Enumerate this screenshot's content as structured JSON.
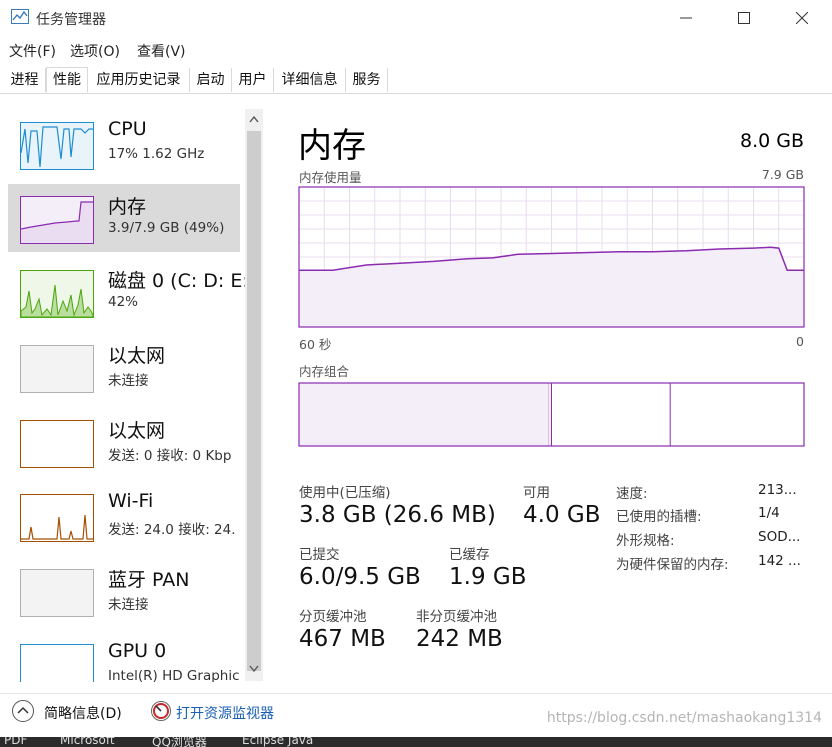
{
  "window": {
    "title": "任务管理器"
  },
  "menu": [
    "文件(F)",
    "选项(O)",
    "查看(V)"
  ],
  "tabs": [
    "进程",
    "性能",
    "应用历史记录",
    "启动",
    "用户",
    "详细信息",
    "服务"
  ],
  "active_tab_index": 1,
  "sidebar": [
    {
      "title": "CPU",
      "subtitle": "17% 1.62 GHz",
      "color": "#1d8ed1",
      "selected": false
    },
    {
      "title": "内存",
      "subtitle": "3.9/7.9 GB (49%)",
      "color": "#8b2bb0",
      "selected": true
    },
    {
      "title": "磁盘 0 (C: D: E:",
      "subtitle": "42%",
      "color": "#4da60c",
      "selected": false
    },
    {
      "title": "以太网",
      "subtitle": "未连接",
      "color": "#a9a9a9",
      "selected": false
    },
    {
      "title": "以太网",
      "subtitle": "发送: 0 接收: 0 Kbp",
      "color": "#a74f01",
      "selected": false
    },
    {
      "title": "Wi-Fi",
      "subtitle": "发送: 24.0 接收: 24.",
      "color": "#a74f01",
      "selected": false
    },
    {
      "title": "蓝牙 PAN",
      "subtitle": "未连接",
      "color": "#a9a9a9",
      "selected": false
    },
    {
      "title": "GPU 0",
      "subtitle": "Intel(R) HD Graphic",
      "color": "#1d8ed1",
      "selected": false
    }
  ],
  "main": {
    "title": "内存",
    "total": "8.0 GB",
    "usage_label": "内存使用量",
    "usage_max": "7.9 GB",
    "x_left": "60 秒",
    "x_right": "0",
    "composition_label": "内存组合",
    "stats": [
      {
        "label": "使用中(已压缩)",
        "value": "3.8 GB (26.6 MB)"
      },
      {
        "label": "可用",
        "value": "4.0 GB"
      },
      {
        "label": "已提交",
        "value": "6.0/9.5 GB"
      },
      {
        "label": "已缓存",
        "value": "1.9 GB"
      },
      {
        "label": "分页缓冲池",
        "value": "467 MB"
      },
      {
        "label": "非分页缓冲池",
        "value": "242 MB"
      }
    ],
    "details": [
      {
        "label": "速度:",
        "value": "213..."
      },
      {
        "label": "已使用的插槽:",
        "value": "1/4"
      },
      {
        "label": "外形规格:",
        "value": "SOD..."
      },
      {
        "label": "为硬件保留的内存:",
        "value": "142 ..."
      }
    ]
  },
  "chart_data": {
    "type": "area",
    "title": "内存使用量",
    "x_range": [
      60,
      0
    ],
    "ylim": [
      0,
      7.9
    ],
    "y_unit": "GB",
    "x": [
      60,
      56,
      52,
      48,
      44,
      40,
      37,
      34,
      30,
      26,
      22,
      18,
      14,
      10,
      6,
      4,
      3,
      2,
      0
    ],
    "values": [
      3.2,
      3.2,
      3.5,
      3.6,
      3.7,
      3.85,
      3.9,
      4.1,
      4.15,
      4.2,
      4.25,
      4.25,
      4.3,
      4.4,
      4.45,
      4.5,
      4.45,
      3.2,
      3.2
    ],
    "composition_fractions": [
      0.5,
      0.235,
      0.265
    ],
    "color": "#8b2bb0",
    "grid": true
  },
  "footer": {
    "fewer_details": "简略信息(D)",
    "open_monitor": "打开资源监视器"
  },
  "watermark": "https://blog.csdn.net/mashaokang1314",
  "taskbar": [
    "PDF",
    "Microsoft",
    "QQ浏览器",
    "Eclipse Java"
  ]
}
